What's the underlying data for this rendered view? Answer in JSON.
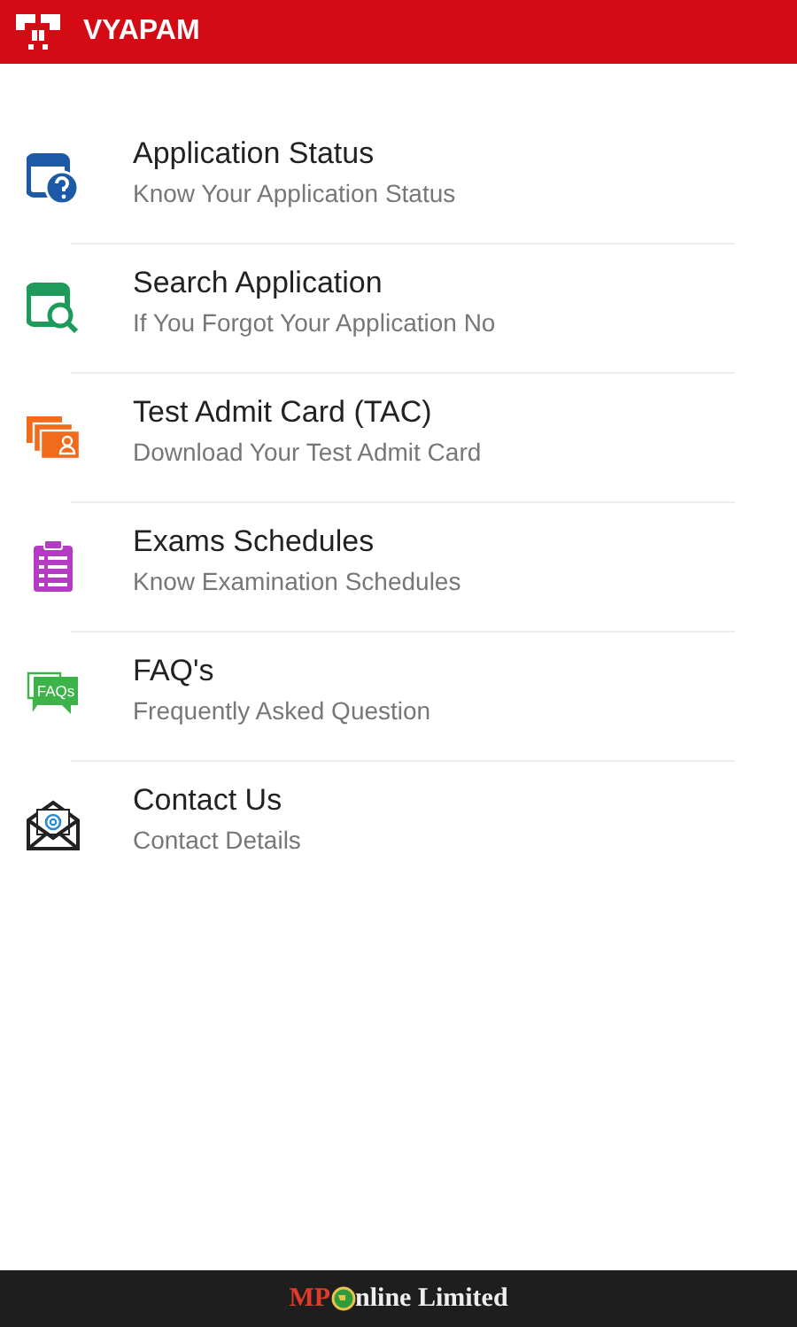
{
  "app_bar": {
    "title": "VYAPAM"
  },
  "menu": [
    {
      "kind": "status",
      "title": "Application Status",
      "subtitle": "Know Your Application Status"
    },
    {
      "kind": "search",
      "title": "Search Application",
      "subtitle": "If You Forgot Your Application No"
    },
    {
      "kind": "card",
      "title": "Test Admit Card (TAC)",
      "subtitle": "Download Your Test Admit Card"
    },
    {
      "kind": "schedule",
      "title": "Exams Schedules",
      "subtitle": "Know Examination Schedules"
    },
    {
      "kind": "faq",
      "title": "FAQ's",
      "subtitle": "Frequently Asked Question",
      "icon_label": "FAQs"
    },
    {
      "kind": "contact",
      "title": "Contact Us",
      "subtitle": "Contact Details"
    }
  ],
  "footer": {
    "brand_start": "MP",
    "brand_end": "nline Limited"
  }
}
